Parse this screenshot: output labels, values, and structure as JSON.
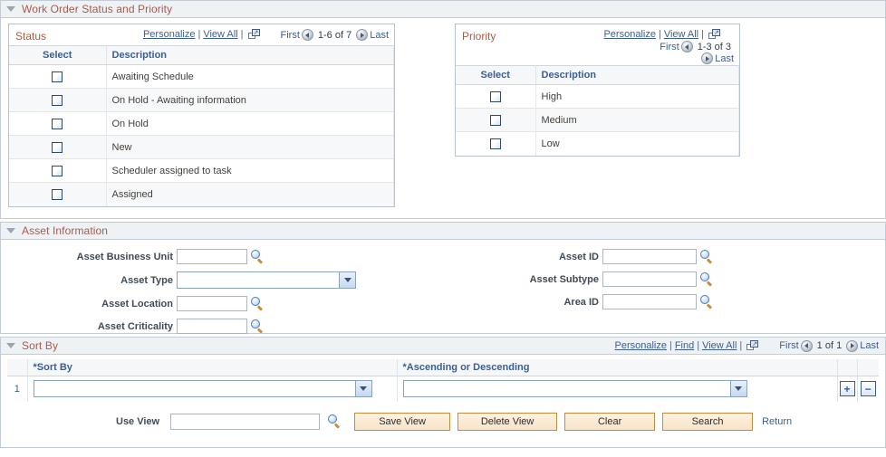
{
  "sections": {
    "status_priority": {
      "title": "Work Order Status and Priority"
    },
    "asset_information": {
      "title": "Asset Information"
    },
    "sort_by": {
      "title": "Sort By"
    }
  },
  "status_grid": {
    "label": "Status",
    "personalize": "Personalize",
    "view_all": "View All",
    "separator": "|",
    "new_window_icon": "new-window-icon",
    "first": "First",
    "counter": "1-6 of 7",
    "last": "Last",
    "columns": [
      "Select",
      "Description"
    ],
    "rows": [
      {
        "description": "Awaiting Schedule",
        "checked": false
      },
      {
        "description": "On Hold - Awaiting information",
        "checked": false
      },
      {
        "description": "On Hold",
        "checked": false
      },
      {
        "description": "New",
        "checked": false
      },
      {
        "description": "Scheduler assigned to task",
        "checked": false
      },
      {
        "description": "Assigned",
        "checked": false
      }
    ]
  },
  "priority_grid": {
    "label": "Priority",
    "personalize": "Personalize",
    "view_all": "View All",
    "separator": "|",
    "new_window_icon": "new-window-icon",
    "first": "First",
    "counter": "1-3 of 3",
    "last": "Last",
    "columns": [
      "Select",
      "Description"
    ],
    "rows": [
      {
        "description": "High",
        "checked": false
      },
      {
        "description": "Medium",
        "checked": false
      },
      {
        "description": "Low",
        "checked": false
      }
    ]
  },
  "asset_information": {
    "left_fields": [
      {
        "label": "Asset Business Unit",
        "value": "",
        "type": "lookup"
      },
      {
        "label": "Asset Type",
        "value": "",
        "type": "dropdown"
      },
      {
        "label": "Asset Location",
        "value": "",
        "type": "lookup"
      },
      {
        "label": "Asset Criticality",
        "value": "",
        "type": "lookup"
      }
    ],
    "right_fields": [
      {
        "label": "Asset ID",
        "value": "",
        "type": "lookup"
      },
      {
        "label": "Asset Subtype",
        "value": "",
        "type": "lookup"
      },
      {
        "label": "Area ID",
        "value": "",
        "type": "lookup"
      }
    ]
  },
  "sort_by": {
    "personalize": "Personalize",
    "find": "Find",
    "view_all": "View All",
    "separator": "|",
    "new_window_icon": "new-window-icon",
    "first": "First",
    "counter": "1 of 1",
    "last": "Last",
    "columns": {
      "sort_by": "*Sort By",
      "direction": "*Ascending or Descending"
    },
    "rows": [
      {
        "index": "1",
        "sort_by_value": "",
        "direction_value": ""
      }
    ],
    "add_row_label": "+",
    "delete_row_label": "−"
  },
  "footer": {
    "use_view_label": "Use View",
    "use_view_value": "",
    "save_view_label": "Save View",
    "delete_view_label": "Delete View",
    "clear_label": "Clear",
    "search_label": "Search",
    "return_label": "Return"
  },
  "colors": {
    "section_header_text": "#a85b4a",
    "grid_label_text": "#b05a43",
    "link": "#3b5e93",
    "button_border": "#c98b3e",
    "section_bar_bg": "#eff2f4"
  }
}
